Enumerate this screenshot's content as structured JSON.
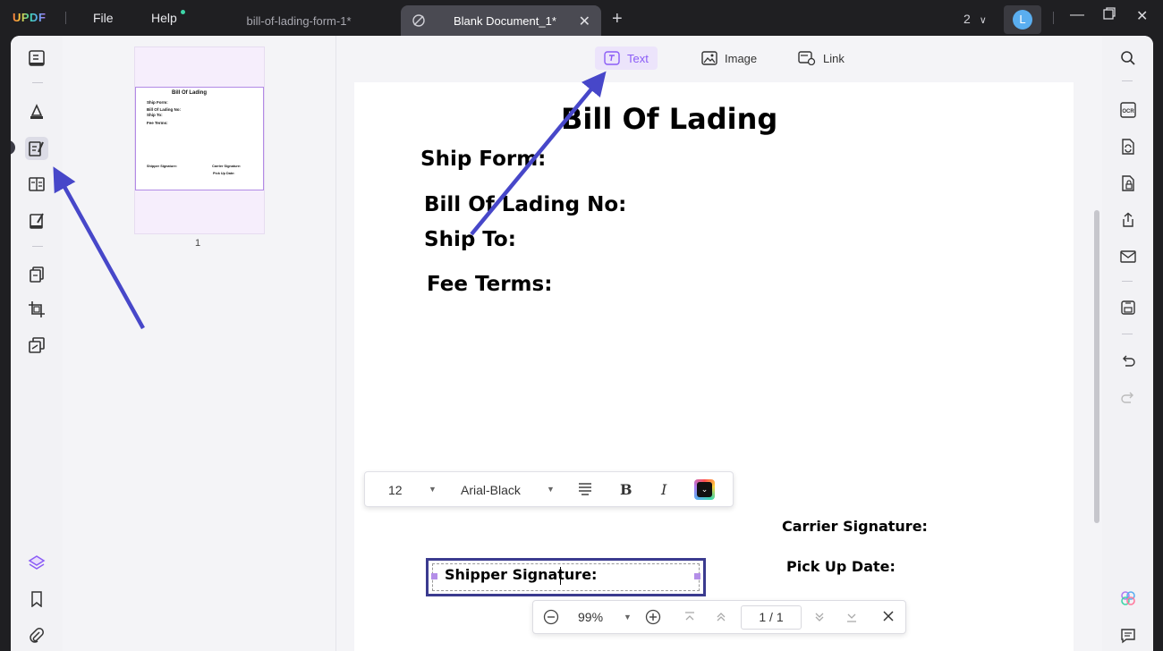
{
  "titlebar": {
    "logo": "UPDF",
    "menu_file": "File",
    "menu_help": "Help",
    "tabs": [
      {
        "label": "bill-of-lading-form-1*",
        "active": false
      },
      {
        "label": "Blank Document_1*",
        "active": true
      }
    ],
    "page_count": "2",
    "avatar_letter": "L"
  },
  "thumbnails": {
    "page_number": "1",
    "thumb_title": "Bill Of Lading",
    "thumb_ship_form": "Ship Form:",
    "thumb_bol_no": "Bill Of Lading No:",
    "thumb_ship_to": "Ship To:",
    "thumb_fee_terms": "Fee Terms:",
    "thumb_shipper": "Shipper Signature:",
    "thumb_carrier": "Carrier Signature:",
    "thumb_pickup": "Pick Up Date:"
  },
  "toolbar": {
    "text_label": "Text",
    "image_label": "Image",
    "link_label": "Link"
  },
  "document": {
    "title": "Bill Of Lading",
    "ship_form": "Ship Form:",
    "bol_no": "Bill Of Lading No:",
    "ship_to": "Ship To:",
    "fee_terms": "Fee Terms:",
    "shipper_signature": "Shipper Signature:",
    "carrier_signature": "Carrier Signature:",
    "pickup_date": "Pick Up Date:"
  },
  "format_bar": {
    "font_size": "12",
    "font_family": "Arial-Black",
    "bold": "B",
    "italic": "I"
  },
  "zoom_bar": {
    "zoom": "99%",
    "page_indicator": "1 / 1"
  },
  "colors": {
    "accent": "#8b5cf6",
    "arrow": "#4747c9",
    "textbox_border": "#3b3b8f",
    "titlebar_bg": "#1f1f22"
  }
}
